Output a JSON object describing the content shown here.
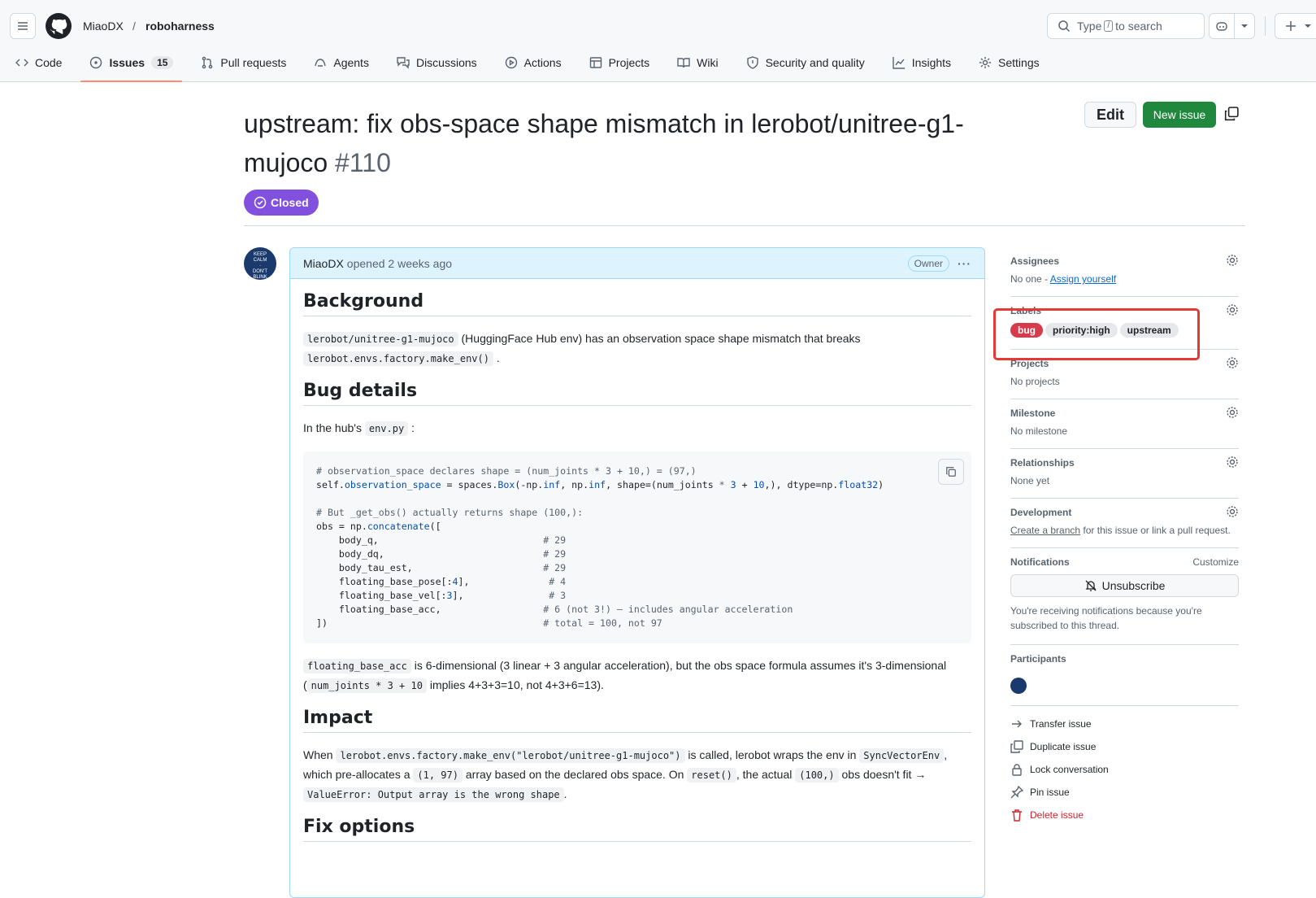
{
  "header": {
    "owner": "MiaoDX",
    "repo": "roboharness",
    "search_prefix": "Type",
    "search_key": "/",
    "search_suffix": "to search"
  },
  "tabs": [
    {
      "label": "Code"
    },
    {
      "label": "Issues",
      "count": "15"
    },
    {
      "label": "Pull requests"
    },
    {
      "label": "Agents"
    },
    {
      "label": "Discussions"
    },
    {
      "label": "Actions"
    },
    {
      "label": "Projects"
    },
    {
      "label": "Wiki"
    },
    {
      "label": "Security and quality"
    },
    {
      "label": "Insights"
    },
    {
      "label": "Settings"
    }
  ],
  "issue": {
    "title": "upstream: fix obs-space shape mismatch in lerobot/unitree-g1-mujoco",
    "number": "#110",
    "state": "Closed",
    "edit_label": "Edit",
    "new_label": "New issue"
  },
  "comment": {
    "author": "MiaoDX",
    "opened": "opened 2 weeks ago",
    "role": "Owner",
    "h_background": "Background",
    "bg_code1": "lerobot/unitree-g1-mujoco",
    "bg_text1": "(HuggingFace Hub env) has an observation space shape mismatch that breaks",
    "bg_code2": "lerobot.envs.factory.make_env()",
    "bg_text2": ".",
    "h_bug": "Bug details",
    "bug_text1": "In the hub's",
    "bug_code1": "env.py",
    "bug_text2": ":",
    "h_impact": "Impact",
    "imp_1": "When",
    "imp_c1": "lerobot.envs.factory.make_env(\"lerobot/unitree-g1-mujoco\")",
    "imp_2": "is called, lerobot wraps the env in",
    "imp_c2": "SyncVectorEnv",
    "imp_3": ",",
    "imp_4": "which pre-allocates a",
    "imp_c3": "(1, 97)",
    "imp_5": "array based on the declared obs space. On",
    "imp_c4": "reset()",
    "imp_6": ", the actual",
    "imp_c5": "(100,)",
    "imp_7": "obs doesn't fit →",
    "imp_c6": "ValueError: Output array is the wrong shape",
    "imp_8": ".",
    "fb_c1": "floating_base_acc",
    "fb_1": "is 6-dimensional (3 linear + 3 angular acceleration), but the obs space formula assumes it's 3-dimensional (",
    "fb_c2": "num_joints * 3 + 10",
    "fb_2": "implies 4+3+3=10, not 4+3+6=13).",
    "h_fix": "Fix options"
  },
  "sidebar": {
    "assignees": {
      "title": "Assignees",
      "none": "No one -",
      "link": "Assign yourself"
    },
    "labels": {
      "title": "Labels",
      "items": [
        {
          "name": "bug",
          "color": "#d73a4a",
          "text": "#ffffff"
        },
        {
          "name": "priority:high",
          "color": "#e6e8eb",
          "text": "#1f2328"
        },
        {
          "name": "upstream",
          "color": "#e6e8eb",
          "text": "#1f2328"
        }
      ]
    },
    "projects": {
      "title": "Projects",
      "value": "No projects"
    },
    "milestone": {
      "title": "Milestone",
      "value": "No milestone"
    },
    "relationships": {
      "title": "Relationships",
      "value": "None yet"
    },
    "development": {
      "title": "Development",
      "link": "Create a branch",
      "text": "for this issue or link a pull request."
    },
    "notifications": {
      "title": "Notifications",
      "customize": "Customize",
      "button": "Unsubscribe",
      "note": "You're receiving notifications because you're subscribed to this thread."
    },
    "participants": {
      "title": "Participants"
    },
    "actions": [
      "Transfer issue",
      "Duplicate issue",
      "Lock conversation",
      "Pin issue",
      "Delete issue"
    ]
  }
}
